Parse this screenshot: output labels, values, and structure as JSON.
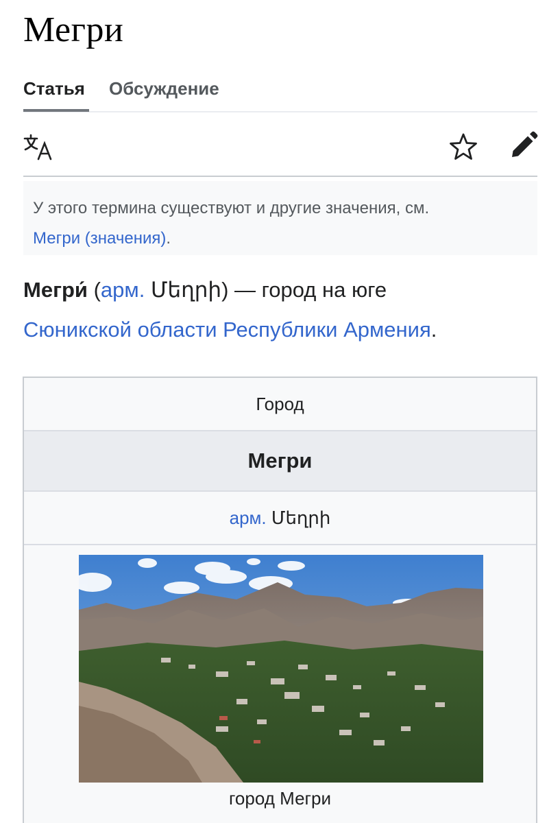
{
  "page": {
    "title": "Мегри"
  },
  "tabs": {
    "article": "Статья",
    "talk": "Обсуждение"
  },
  "toolbar": {
    "icons": [
      "language-icon",
      "star-icon",
      "edit-pencil-icon"
    ]
  },
  "hatnote": {
    "text": "У этого термина существуют и другие значения, см.",
    "link": "Мегри (значения)",
    "suffix": "."
  },
  "lead": {
    "name": "Мегри́",
    "open_paren": " (",
    "lang_link": "арм.",
    "native": " Մեղրի",
    "rest": ") — город на юге",
    "region_link": "Сюникской области Республики Армения",
    "end": "."
  },
  "infobox": {
    "type": "Город",
    "name": "Мегри",
    "lang_link": "арм.",
    "native": " Մեղրի",
    "image_caption": "город Мегри"
  },
  "colors": {
    "link": "#3366cc",
    "text": "#202122",
    "muted": "#54595d",
    "infobox_bg": "#f8f9fa"
  }
}
